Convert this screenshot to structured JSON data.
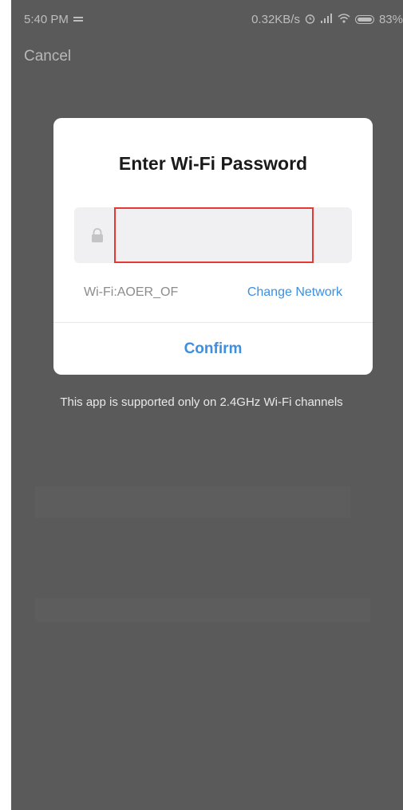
{
  "status_bar": {
    "time": "5:40 PM",
    "network_speed": "0.32KB/s",
    "battery_percent": "83%"
  },
  "header": {
    "cancel_label": "Cancel"
  },
  "dialog": {
    "title": "Enter Wi-Fi Password",
    "password": {
      "value": "",
      "placeholder": ""
    },
    "wifi_label": "Wi-Fi:AOER_OF",
    "change_network_label": "Change Network",
    "confirm_label": "Confirm"
  },
  "note": "This app is supported only on 2.4GHz Wi-Fi channels",
  "colors": {
    "accent": "#3d8fe0",
    "highlight_border": "#e53935",
    "overlay": "#5a5a5a"
  }
}
